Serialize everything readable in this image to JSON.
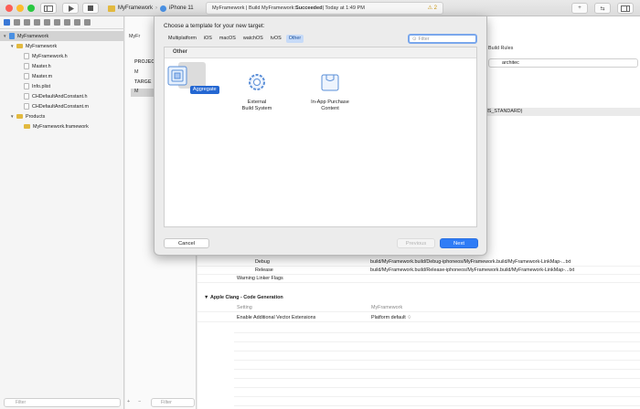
{
  "toolbar": {
    "scheme": "MyFramework",
    "device": "iPhone 11",
    "activity_project": "MyFramework | Build MyFramework: ",
    "activity_status": "Succeeded",
    "activity_time": " | Today at 1:49 PM",
    "warning_count": "2"
  },
  "navigator": {
    "items": [
      {
        "label": "MyFramework",
        "level": 0,
        "kind": "project"
      },
      {
        "label": "MyFramework",
        "level": 1,
        "kind": "folder"
      },
      {
        "label": "MyFramework.h",
        "level": 2,
        "kind": "file"
      },
      {
        "label": "Master.h",
        "level": 2,
        "kind": "file"
      },
      {
        "label": "Master.m",
        "level": 2,
        "kind": "file"
      },
      {
        "label": "Info.plist",
        "level": 2,
        "kind": "file"
      },
      {
        "label": "CHDefaultAndConstant.h",
        "level": 2,
        "kind": "file"
      },
      {
        "label": "CHDefaultAndConstant.m",
        "level": 2,
        "kind": "file"
      },
      {
        "label": "Products",
        "level": 1,
        "kind": "folder"
      },
      {
        "label": "MyFramework.framework",
        "level": 2,
        "kind": "product"
      }
    ],
    "filter_placeholder": "Filter"
  },
  "target_list": {
    "tab_label": "MyFr",
    "project_header": "PROJEC",
    "project_item": "M",
    "targets_header": "TARGE",
    "target_item": "M",
    "filter_placeholder": "Filter"
  },
  "editor": {
    "build_rules_tab": "Build Rules",
    "search_value": "architec",
    "arch_value": "CHS_STANDARD)",
    "debug_label": "Debug",
    "debug_value": "build/MyFramework.build/Debug-iphoneos/MyFramework.build/MyFramework-LinkMap-...txt",
    "release_label": "Release",
    "release_value": "build/MyFramework.build/Release-iphoneos/MyFramework.build/MyFramework-LinkMap-...txt",
    "warning_flags_label": "Warning Linker Flags",
    "section_title": "Apple Clang - Code Generation",
    "setting_header": "Setting",
    "setting_target": "MyFramework",
    "vector_label": "Enable Additional Vector Extensions",
    "vector_value": "Platform default ♢"
  },
  "sheet": {
    "title": "Choose a template for your new target:",
    "platforms": [
      "Multiplatform",
      "iOS",
      "macOS",
      "watchOS",
      "tvOS",
      "Other"
    ],
    "active_platform": "Other",
    "filter_placeholder": "Filter",
    "section_header": "Other",
    "templates": [
      {
        "label": "Aggregate",
        "selected": true,
        "icon": "aggregate-icon"
      },
      {
        "label": "External\nBuild System",
        "selected": false,
        "icon": "gear-icon"
      },
      {
        "label": "In-App Purchase\nContent",
        "selected": false,
        "icon": "package-icon"
      }
    ],
    "cancel_label": "Cancel",
    "previous_label": "Previous",
    "next_label": "Next"
  },
  "colors": {
    "accent": "#2f7cf6",
    "selection": "#2467d2",
    "warning": "#c7920b"
  }
}
